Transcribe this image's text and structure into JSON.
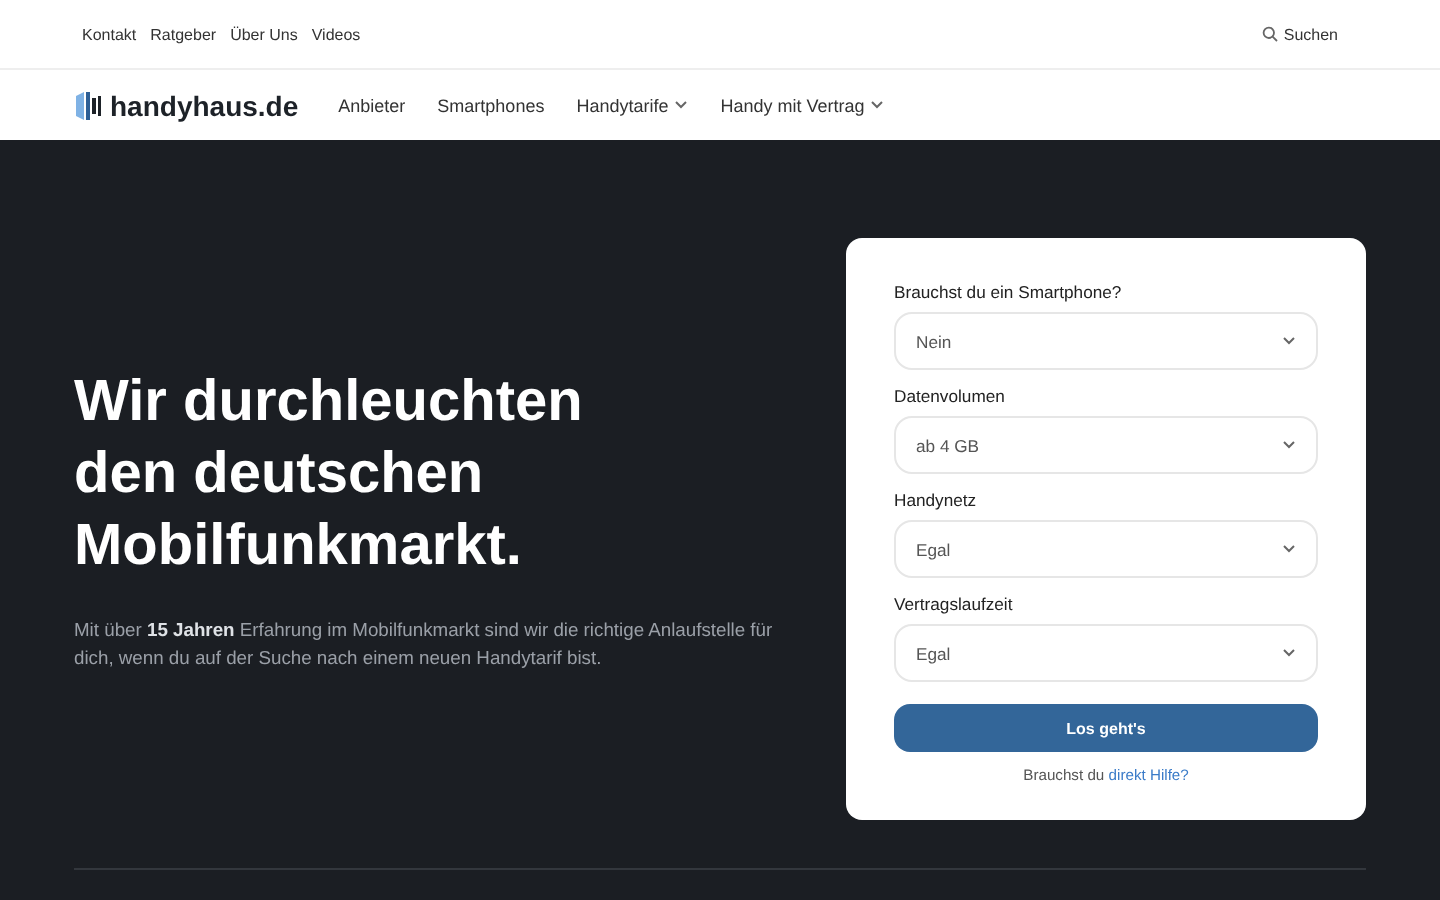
{
  "top_links": [
    "Kontakt",
    "Ratgeber",
    "Über Uns",
    "Videos"
  ],
  "search": {
    "label": "Suchen"
  },
  "logo": {
    "text": "handyhaus.de"
  },
  "nav": [
    {
      "label": "Anbieter",
      "dropdown": false
    },
    {
      "label": "Smartphones",
      "dropdown": false
    },
    {
      "label": "Handytarife",
      "dropdown": true
    },
    {
      "label": "Handy mit Vertrag",
      "dropdown": true
    }
  ],
  "hero": {
    "headline": [
      "Wir durchleuchten",
      "den deutschen",
      "Mobilfunkmarkt."
    ],
    "intro": "Mit über **15 Jahren** Erfahrung im Mobilfunkmarkt sind wir die richtige Anlaufstelle für dich, wenn du auf der Suche nach einem neuen Handytarif bist."
  },
  "form": {
    "fields": [
      {
        "label": "Brauchst du ein Smartphone?",
        "value": "Nein"
      },
      {
        "label": "Datenvolumen",
        "value": "ab 4 GB"
      },
      {
        "label": "Handynetz",
        "value": "Egal"
      },
      {
        "label": "Vertragslaufzeit",
        "value": "Egal"
      }
    ],
    "submit": "Los geht's",
    "help_text": "Brauchst du",
    "help_link": "direkt Hilfe?"
  }
}
